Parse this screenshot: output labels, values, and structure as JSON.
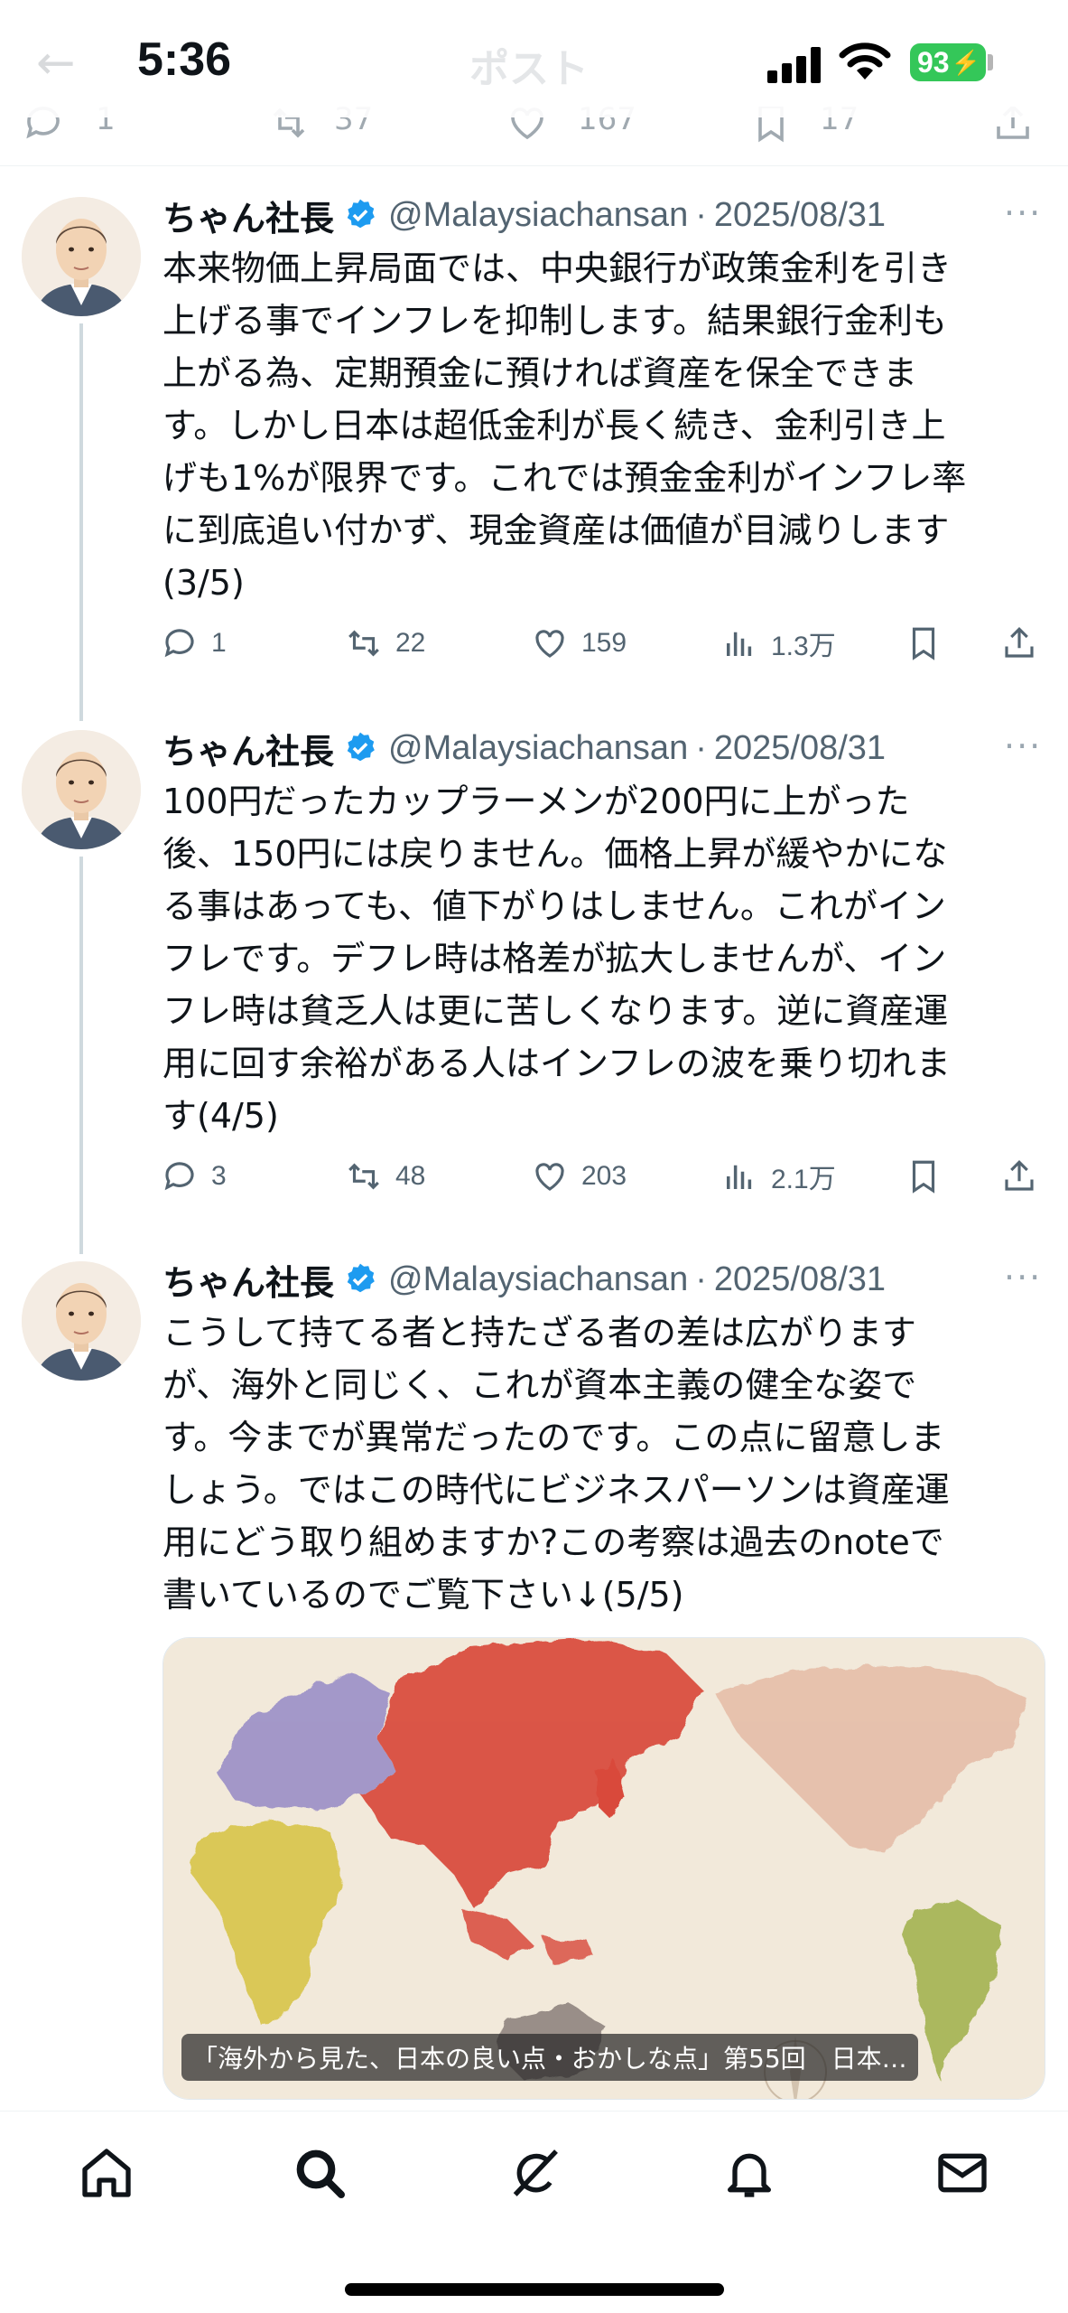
{
  "status_bar": {
    "time": "5:36",
    "battery": "93",
    "header_title_ghost": "ポスト"
  },
  "previous_actions": {
    "replies": "1",
    "reposts": "37",
    "likes": "167",
    "bookmarks": "17"
  },
  "tweets": [
    {
      "name": "ちゃん社長",
      "handle": "@Malaysiachansan",
      "separator": "·",
      "date": "2025/08/31",
      "lines": [
        "本来物価上昇局面では、中央銀行が政策金利を引き",
        "上げる事でインフレを抑制します。結果銀行金利も",
        "上がる為、定期預金に預ければ資産を保全できま",
        "す。しかし日本は超低金利が長く続き、金利引き上",
        "げも1%が限界です。これでは預金金利がインフレ率",
        "に到底追い付かず、現金資産は価値が目減りします",
        "(3/5)"
      ],
      "replies": "1",
      "reposts": "22",
      "likes": "159",
      "views": "1.3万"
    },
    {
      "name": "ちゃん社長",
      "handle": "@Malaysiachansan",
      "separator": "·",
      "date": "2025/08/31",
      "lines": [
        "100円だったカップラーメンが200円に上がった",
        "後、150円には戻りません。価格上昇が緩やかにな",
        "る事はあっても、値下がりはしません。これがイン",
        "フレです。デフレ時は格差が拡大しませんが、イン",
        "フレ時は貧乏人は更に苦しくなります。逆に資産運",
        "用に回す余裕がある人はインフレの波を乗り切れま",
        "す(4/5)"
      ],
      "replies": "3",
      "reposts": "48",
      "likes": "203",
      "views": "2.1万"
    },
    {
      "name": "ちゃん社長",
      "handle": "@Malaysiachansan",
      "separator": "·",
      "date": "2025/08/31",
      "lines": [
        "こうして持てる者と持たざる者の差は広がります",
        "が、海外と同じく、これが資本主義の健全な姿で",
        "す。今までが異常だったのです。この点に留意しま",
        "しょう。ではこの時代にビジネスパーソンは資産運",
        "用にどう取り組めますか?この考察は過去のnoteで",
        "書いているのでご覧下さい↓(5/5)"
      ]
    }
  ],
  "link_card": {
    "caption": "「海外から見た、日本の良い点・おかしな点」第55回　日本…"
  },
  "colors": {
    "text": "#0f1419",
    "muted": "#536471",
    "verified": "#1d9bf0",
    "battery": "#34c759"
  },
  "icons": [
    "reply-icon",
    "repost-icon",
    "like-icon",
    "views-icon",
    "bookmark-icon",
    "share-icon",
    "verified-badge-icon",
    "more-icon",
    "home-icon",
    "search-icon",
    "grok-icon",
    "notifications-icon",
    "messages-icon"
  ]
}
